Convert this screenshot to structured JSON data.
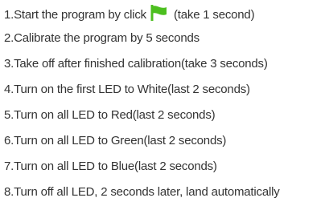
{
  "colors": {
    "text": "#333333",
    "flag_green": "#4cbf1f"
  },
  "steps": [
    {
      "before_icon": "1.Start the program by click",
      "icon": "green-flag-icon",
      "after_icon": "(take 1 second)"
    },
    {
      "text": "2.Calibrate the program by 5 seconds"
    },
    {
      "text": "3.Take off after finished calibration(take 3 seconds)"
    },
    {
      "text": "4.Turn on the first LED to White(last 2 seconds)"
    },
    {
      "text": "5.Turn on all LED to Red(last 2 seconds)"
    },
    {
      "text": "6.Turn on all LED to Green(last 2 seconds)"
    },
    {
      "text": "7.Turn on all LED to Blue(last 2 seconds)"
    },
    {
      "text": "8.Turn off all LED, 2 seconds later, land automatically"
    }
  ]
}
